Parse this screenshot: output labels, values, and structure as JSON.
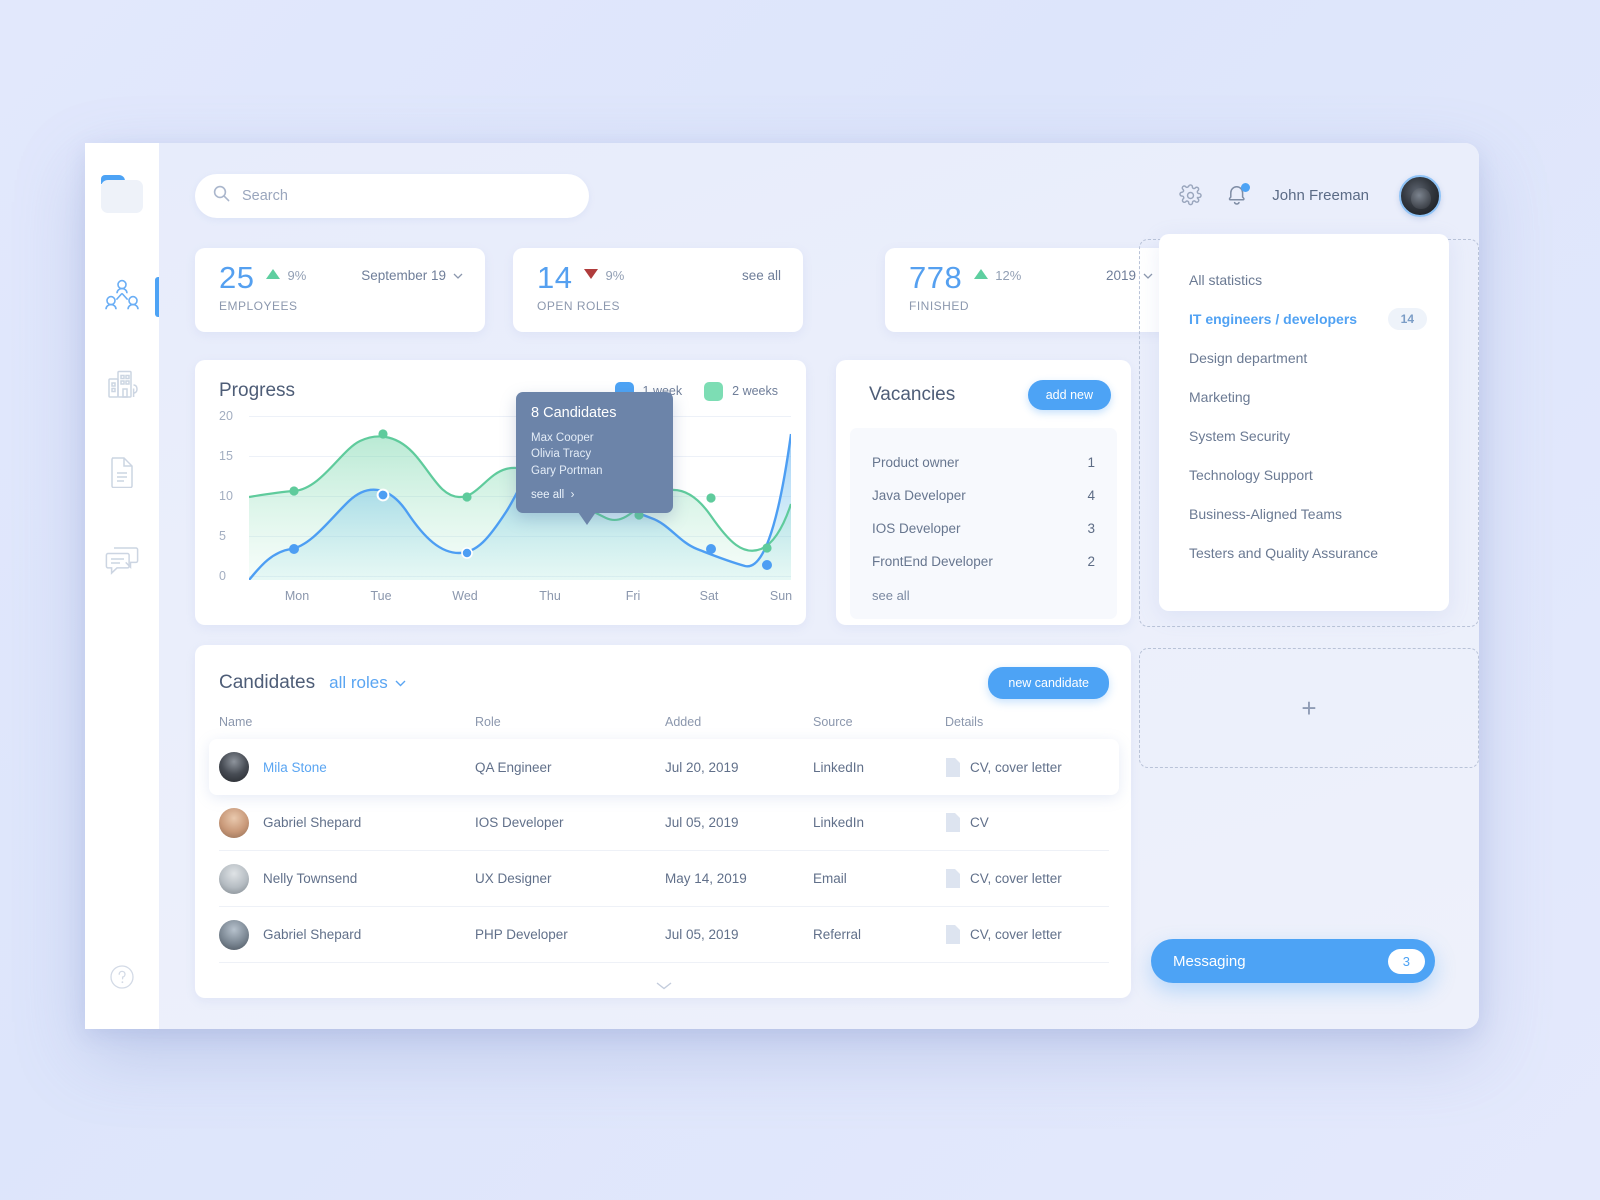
{
  "sidebar": {
    "logo_name": "app-logo",
    "items": [
      {
        "name": "team-icon",
        "label": "Team",
        "active": true
      },
      {
        "name": "company-icon",
        "label": "Company",
        "active": false
      },
      {
        "name": "documents-icon",
        "label": "Documents",
        "active": false
      },
      {
        "name": "messages-icon",
        "label": "Messages",
        "active": false
      }
    ],
    "help_label": "Help"
  },
  "header": {
    "search_placeholder": "Search",
    "search_value": "",
    "user_name": "John Freeman",
    "settings_icon": "gear-icon",
    "notifications_icon": "bell-icon",
    "has_notification": true
  },
  "stats": [
    {
      "value": "25",
      "trend": "up",
      "percent": "9%",
      "label": "EMPLOYEES",
      "action": "September 19",
      "action_type": "dropdown"
    },
    {
      "value": "14",
      "trend": "down",
      "percent": "9%",
      "label": "OPEN ROLES",
      "action": "see all",
      "action_type": "link"
    },
    {
      "value": "778",
      "trend": "up",
      "percent": "12%",
      "label": "FINISHED",
      "action": "2019",
      "action_type": "dropdown"
    }
  ],
  "progress": {
    "title": "Progress",
    "legend": [
      {
        "label": "1 week",
        "color": "#4da3f5"
      },
      {
        "label": "2 weeks",
        "color": "#7dddb4"
      }
    ],
    "tooltip": {
      "title": "8 Candidates",
      "names": [
        "Max Cooper",
        "Olivia Tracy",
        "Gary Portman"
      ],
      "see_all": "see all"
    }
  },
  "chart_data": {
    "type": "line",
    "title": "Progress",
    "xlabel": "",
    "ylabel": "",
    "categories": [
      "Mon",
      "Tue",
      "Wed",
      "Thu",
      "Fri",
      "Sat",
      "Sun"
    ],
    "ylim": [
      0,
      20
    ],
    "yticks": [
      0,
      5,
      10,
      15,
      20
    ],
    "grid": true,
    "legend_position": "top-right",
    "series": [
      {
        "name": "1 week",
        "color": "#4da3f5",
        "values": [
          2.7,
          10.3,
          4.8,
          17.2,
          9.0,
          4.8,
          1.4
        ]
      },
      {
        "name": "2 weeks",
        "color": "#6ed3a6",
        "values": [
          8.5,
          17.2,
          9.6,
          10.2,
          6.7,
          10.0,
          3.2
        ]
      }
    ],
    "annotation": {
      "at": "Fri",
      "series": "1 week",
      "title": "8 Candidates",
      "items": [
        "Max Cooper",
        "Olivia Tracy",
        "Gary Portman"
      ]
    }
  },
  "vacancies": {
    "title": "Vacancies",
    "add_label": "add new",
    "rows": [
      {
        "role": "Product owner",
        "count": "1"
      },
      {
        "role": "Java Developer",
        "count": "4"
      },
      {
        "role": "IOS Developer",
        "count": "3"
      },
      {
        "role": "FrontEnd Developer",
        "count": "2"
      }
    ],
    "see_all": "see all"
  },
  "candidates": {
    "title": "Candidates",
    "filter": "all roles",
    "new_label": "new candidate",
    "columns": [
      "Name",
      "Role",
      "Added",
      "Source",
      "Details"
    ],
    "rows": [
      {
        "name": "Mila Stone",
        "role": "QA Engineer",
        "added": "Jul 20, 2019",
        "source": "LinkedIn",
        "details": "CV, cover letter",
        "selected": true
      },
      {
        "name": "Gabriel Shepard",
        "role": "IOS Developer",
        "added": "Jul 05, 2019",
        "source": "LinkedIn",
        "details": "CV",
        "selected": false
      },
      {
        "name": "Nelly Townsend",
        "role": "UX Designer",
        "added": "May 14, 2019",
        "source": "Email",
        "details": "CV, cover letter",
        "selected": false
      },
      {
        "name": "Gabriel Shepard",
        "role": "PHP Developer",
        "added": "Jul 05, 2019",
        "source": "Referral",
        "details": "CV, cover letter",
        "selected": false
      }
    ],
    "expand_icon": "chevron-down-icon"
  },
  "statistics_panel": {
    "items": [
      {
        "label": "All  statistics",
        "badge": "",
        "active": false
      },
      {
        "label": "IT engineers / developers",
        "badge": "14",
        "active": true
      },
      {
        "label": "Design department",
        "badge": "",
        "active": false
      },
      {
        "label": "Marketing",
        "badge": "",
        "active": false
      },
      {
        "label": "System Security",
        "badge": "",
        "active": false
      },
      {
        "label": "Technology Support",
        "badge": "",
        "active": false
      },
      {
        "label": "Business-Aligned Teams",
        "badge": "",
        "active": false
      },
      {
        "label": "Testers and Quality Assurance",
        "badge": "",
        "active": false
      }
    ],
    "add_widget_icon": "plus-icon"
  },
  "messaging": {
    "label": "Messaging",
    "count": "3"
  },
  "colors": {
    "accent": "#4da3f5",
    "green": "#6ed3a6",
    "down": "#b03c3c",
    "tooltip_bg": "#6c84a9",
    "page_bg": "#e2e8fc"
  }
}
